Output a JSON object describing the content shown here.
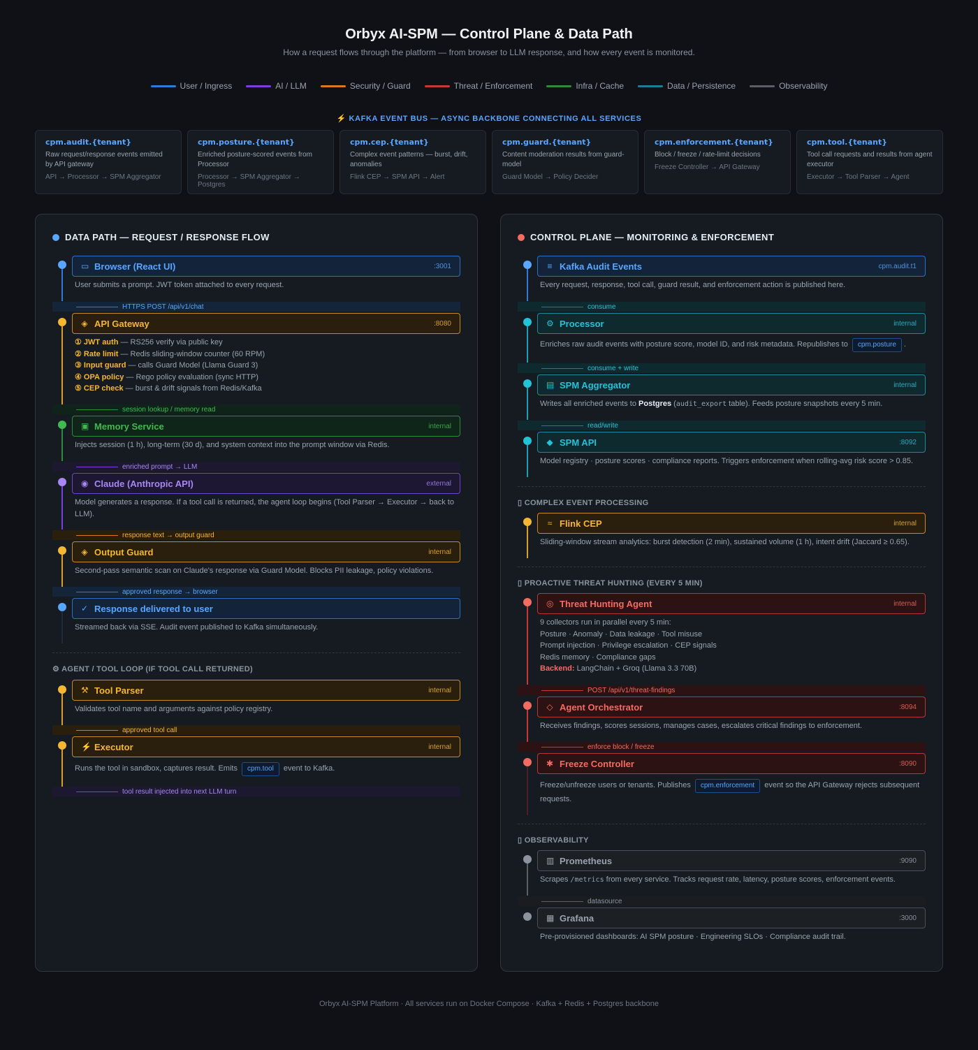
{
  "header": {
    "title": "Orbyx AI-SPM — Control Plane & Data Path",
    "subtitle": "How a request flows through the platform — from browser to LLM response, and how every event is monitored."
  },
  "legend": [
    {
      "label": "User / Ingress",
      "color": "#2f7bd8"
    },
    {
      "label": "AI / LLM",
      "color": "#7b3fe0"
    },
    {
      "label": "Security / Guard",
      "color": "#d97a1e"
    },
    {
      "label": "Threat / Enforcement",
      "color": "#c93636"
    },
    {
      "label": "Infra / Cache",
      "color": "#2e8b3a"
    },
    {
      "label": "Data / Persistence",
      "color": "#1b7f94"
    },
    {
      "label": "Observability",
      "color": "#5a5f66"
    }
  ],
  "kafka": {
    "title": "⚡ KAFKA EVENT BUS — ASYNC BACKBONE CONNECTING ALL SERVICES",
    "topics": [
      {
        "name": "cpm.audit.{tenant}",
        "desc": "Raw request/response events emitted by API gateway",
        "flow": "API → Processor → SPM Aggregator"
      },
      {
        "name": "cpm.posture.{tenant}",
        "desc": "Enriched posture-scored events from Processor",
        "flow": "Processor → SPM Aggregator → Postgres"
      },
      {
        "name": "cpm.cep.{tenant}",
        "desc": "Complex event patterns — burst, drift, anomalies",
        "flow": "Flink CEP → SPM API → Alert"
      },
      {
        "name": "cpm.guard.{tenant}",
        "desc": "Content moderation results from guard-model",
        "flow": "Guard Model → Policy Decider"
      },
      {
        "name": "cpm.enforcement.{tenant}",
        "desc": "Block / freeze / rate-limit decisions",
        "flow": "Freeze Controller → API Gateway"
      },
      {
        "name": "cpm.tool.{tenant}",
        "desc": "Tool call requests and results from agent executor",
        "flow": "Executor → Tool Parser → Agent"
      }
    ]
  },
  "left": {
    "title": "DATA PATH — REQUEST / RESPONSE FLOW",
    "browser": {
      "icon": "monitor-icon",
      "glyph": "▭",
      "name": "Browser (React UI)",
      "port": ":3001",
      "desc": "User submits a prompt. JWT token attached to every request."
    },
    "c1": "HTTPS POST /api/v1/chat",
    "gateway": {
      "icon": "shield-icon",
      "glyph": "◈",
      "name": "API Gateway",
      "port": ":8080",
      "steps": [
        {
          "b": "① JWT auth",
          "t": " — RS256 verify via public key"
        },
        {
          "b": "② Rate limit",
          "t": " — Redis sliding-window counter (60 RPM)"
        },
        {
          "b": "③ Input guard",
          "t": " — calls Guard Model (Llama Guard 3)"
        },
        {
          "b": "④ OPA policy",
          "t": " — Rego policy evaluation (sync HTTP)"
        },
        {
          "b": "⑤ CEP check",
          "t": " — burst & drift signals from Redis/Kafka"
        }
      ]
    },
    "c2": "session lookup / memory read",
    "memory": {
      "icon": "memory-icon",
      "glyph": "▣",
      "name": "Memory Service",
      "port": "internal",
      "desc": "Injects session (1 h), long-term (30 d), and system context into the prompt window via Redis."
    },
    "c3": "enriched prompt → LLM",
    "claude": {
      "icon": "brain-icon",
      "glyph": "◉",
      "name": "Claude (Anthropic API)",
      "port": "external",
      "desc": "Model generates a response. If a tool call is returned, the agent loop begins (Tool Parser → Executor → back to LLM)."
    },
    "c4": "response text → output guard",
    "output": {
      "icon": "shield-check-icon",
      "glyph": "◈",
      "name": "Output Guard",
      "port": "internal",
      "desc": "Second-pass semantic scan on Claude's response via Guard Model. Blocks PII leakage, policy violations."
    },
    "c5": "approved response → browser",
    "response": {
      "icon": "check-icon",
      "glyph": "✓",
      "name": "Response delivered to user",
      "desc": "Streamed back via SSE. Audit event published to Kafka simultaneously."
    },
    "agent_section": "⚙ AGENT / TOOL LOOP (IF TOOL CALL RETURNED)",
    "toolparser": {
      "icon": "wrench-icon",
      "glyph": "⚒",
      "name": "Tool Parser",
      "port": "internal",
      "desc": "Validates tool name and arguments against policy registry."
    },
    "c6": "approved tool call",
    "executor": {
      "icon": "lightning-icon",
      "glyph": "⚡",
      "name": "Executor",
      "port": "internal",
      "desc_a": "Runs the tool in sandbox, captures result. Emits",
      "chip": "cpm.tool",
      "desc_b": "event to Kafka."
    },
    "c7": "tool result injected into next LLM turn"
  },
  "right": {
    "title": "CONTROL PLANE — MONITORING & ENFORCEMENT",
    "kafka": {
      "icon": "stream-icon",
      "glyph": "≡",
      "name": "Kafka Audit Events",
      "port": "cpm.audit.t1",
      "desc": "Every request, response, tool call, guard result, and enforcement action is published here."
    },
    "c1": "consume",
    "processor": {
      "icon": "gear-icon",
      "glyph": "⚙",
      "name": "Processor",
      "port": "internal",
      "desc_a": "Enriches raw audit events with posture score, model ID, and risk metadata. Republishes to",
      "chip": "cpm.posture",
      "desc_b": "."
    },
    "c2": "consume + write",
    "aggregator": {
      "icon": "database-icon",
      "glyph": "▤",
      "name": "SPM Aggregator",
      "port": "internal",
      "desc_a": "Writes all enriched events to ",
      "desc_bold": "Postgres",
      "desc_b": " (",
      "code": "audit_export",
      "desc_c": " table). Feeds posture snapshots every 5 min."
    },
    "c3": "read/write",
    "spmapi": {
      "icon": "api-icon",
      "glyph": "◆",
      "name": "SPM API",
      "port": ":8092",
      "desc": "Model registry · posture scores · compliance reports. Triggers enforcement when rolling-avg risk score > 0.85."
    },
    "cep_section": "▯ COMPLEX EVENT PROCESSING",
    "flink": {
      "icon": "stream-icon",
      "glyph": "≈",
      "name": "Flink CEP",
      "port": "internal",
      "desc": "Sliding-window stream analytics: burst detection (2 min), sustained volume (1 h), intent drift (Jaccard ≥ 0.65)."
    },
    "hunt_section": "▯ PROACTIVE THREAT HUNTING (EVERY 5 MIN)",
    "hunter": {
      "icon": "target-icon",
      "glyph": "◎",
      "name": "Threat Hunting Agent",
      "port": "internal",
      "lines": [
        "9 collectors run in parallel every 5 min:",
        "Posture · Anomaly · Data leakage · Tool misuse",
        "Prompt injection · Privilege escalation · CEP signals",
        "Redis memory · Compliance gaps"
      ],
      "backend_label": "Backend:",
      "backend": " LangChain + Groq (Llama 3.3 70B)"
    },
    "c4": "POST /api/v1/threat-findings",
    "orchestrator": {
      "icon": "orchestrator-icon",
      "glyph": "◇",
      "name": "Agent Orchestrator",
      "port": ":8094",
      "desc": "Receives findings, scores sessions, manages cases, escalates critical findings to enforcement."
    },
    "c5": "enforce block / freeze",
    "freeze": {
      "icon": "freeze-icon",
      "glyph": "✱",
      "name": "Freeze Controller",
      "port": ":8090",
      "desc_a": "Freeze/unfreeze users or tenants. Publishes",
      "chip": "cpm.enforcement",
      "desc_b": "event so the API Gateway rejects subsequent requests."
    },
    "obs_section": "▯ OBSERVABILITY",
    "prometheus": {
      "icon": "chart-icon",
      "glyph": "▥",
      "name": "Prometheus",
      "port": ":9090",
      "desc_a": "Scrapes ",
      "code": "/metrics",
      "desc_b": " from every service. Tracks request rate, latency, posture scores, enforcement events."
    },
    "c6": "datasource",
    "grafana": {
      "icon": "dashboard-icon",
      "glyph": "▦",
      "name": "Grafana",
      "port": ":3000",
      "desc": "Pre-provisioned dashboards: AI SPM posture · Engineering SLOs · Compliance audit trail."
    }
  },
  "footer": "Orbyx AI-SPM Platform · All services run on Docker Compose · Kafka + Redis + Postgres backbone",
  "colors": {
    "blue": "#58a6ff",
    "orange": "#f5b731",
    "green": "#3fb950",
    "purple": "#a887f5",
    "teal": "#22c3d6",
    "red": "#f36b61",
    "gray": "#8b949e"
  }
}
